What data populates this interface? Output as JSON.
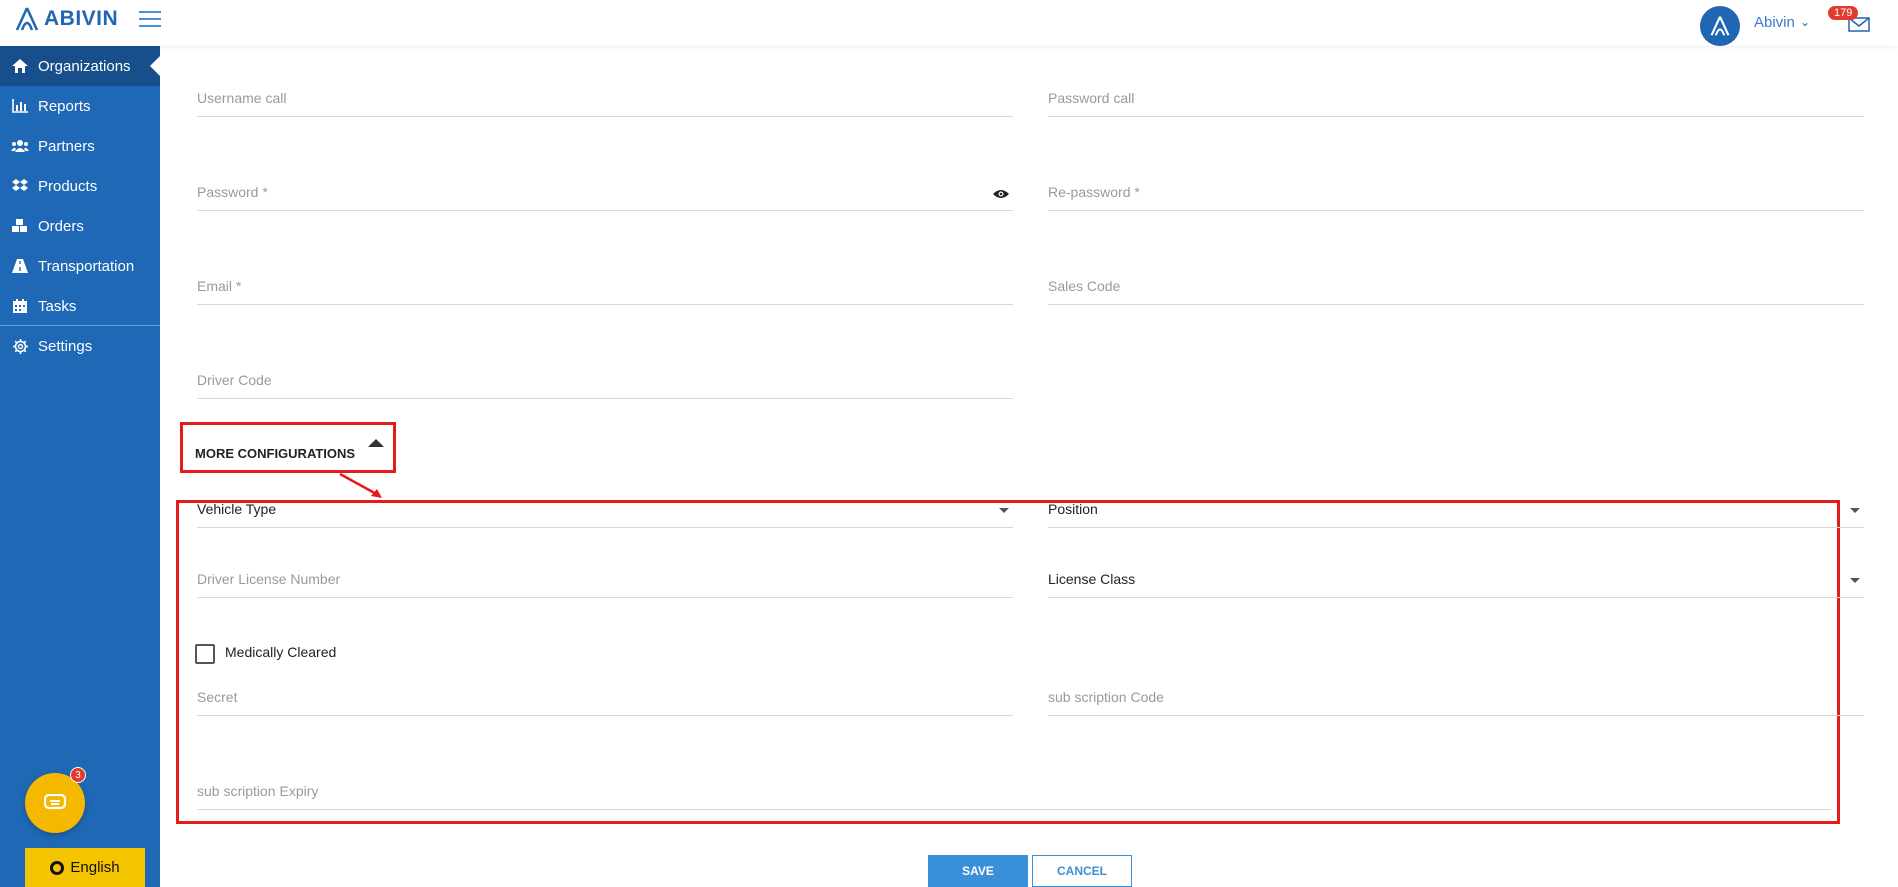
{
  "header": {
    "logo_text": "ABIVIN",
    "user_name": "Abivin",
    "mail_count": "179"
  },
  "sidebar": {
    "items": [
      {
        "label": "Organizations",
        "icon": "home-icon"
      },
      {
        "label": "Reports",
        "icon": "bar-chart-icon"
      },
      {
        "label": "Partners",
        "icon": "users-icon"
      },
      {
        "label": "Products",
        "icon": "dropbox-icon"
      },
      {
        "label": "Orders",
        "icon": "cubes-icon"
      },
      {
        "label": "Transportation",
        "icon": "road-icon"
      },
      {
        "label": "Tasks",
        "icon": "calendar-icon"
      },
      {
        "label": "Settings",
        "icon": "gear-icon"
      }
    ],
    "chat_badge": "3",
    "language": "English"
  },
  "form": {
    "username_call": "Username call",
    "password_call": "Password call",
    "password": "Password *",
    "re_password": "Re-password *",
    "email": "Email *",
    "sales_code": "Sales Code",
    "driver_code": "Driver Code",
    "more_configurations": "MORE CONFIGURATIONS",
    "vehicle_type": "Vehicle Type",
    "position": "Position",
    "driver_license_number": "Driver License Number",
    "license_class": "License Class",
    "medically_cleared": "Medically Cleared",
    "secret": "Secret",
    "subscription_code": "sub scription Code",
    "subscription_expiry": "sub scription Expiry"
  },
  "actions": {
    "save": "SAVE",
    "cancel": "CANCEL"
  },
  "colors": {
    "sidebar": "#1e68b5",
    "accent": "#3a8fd9",
    "highlight": "#e31b1b"
  }
}
